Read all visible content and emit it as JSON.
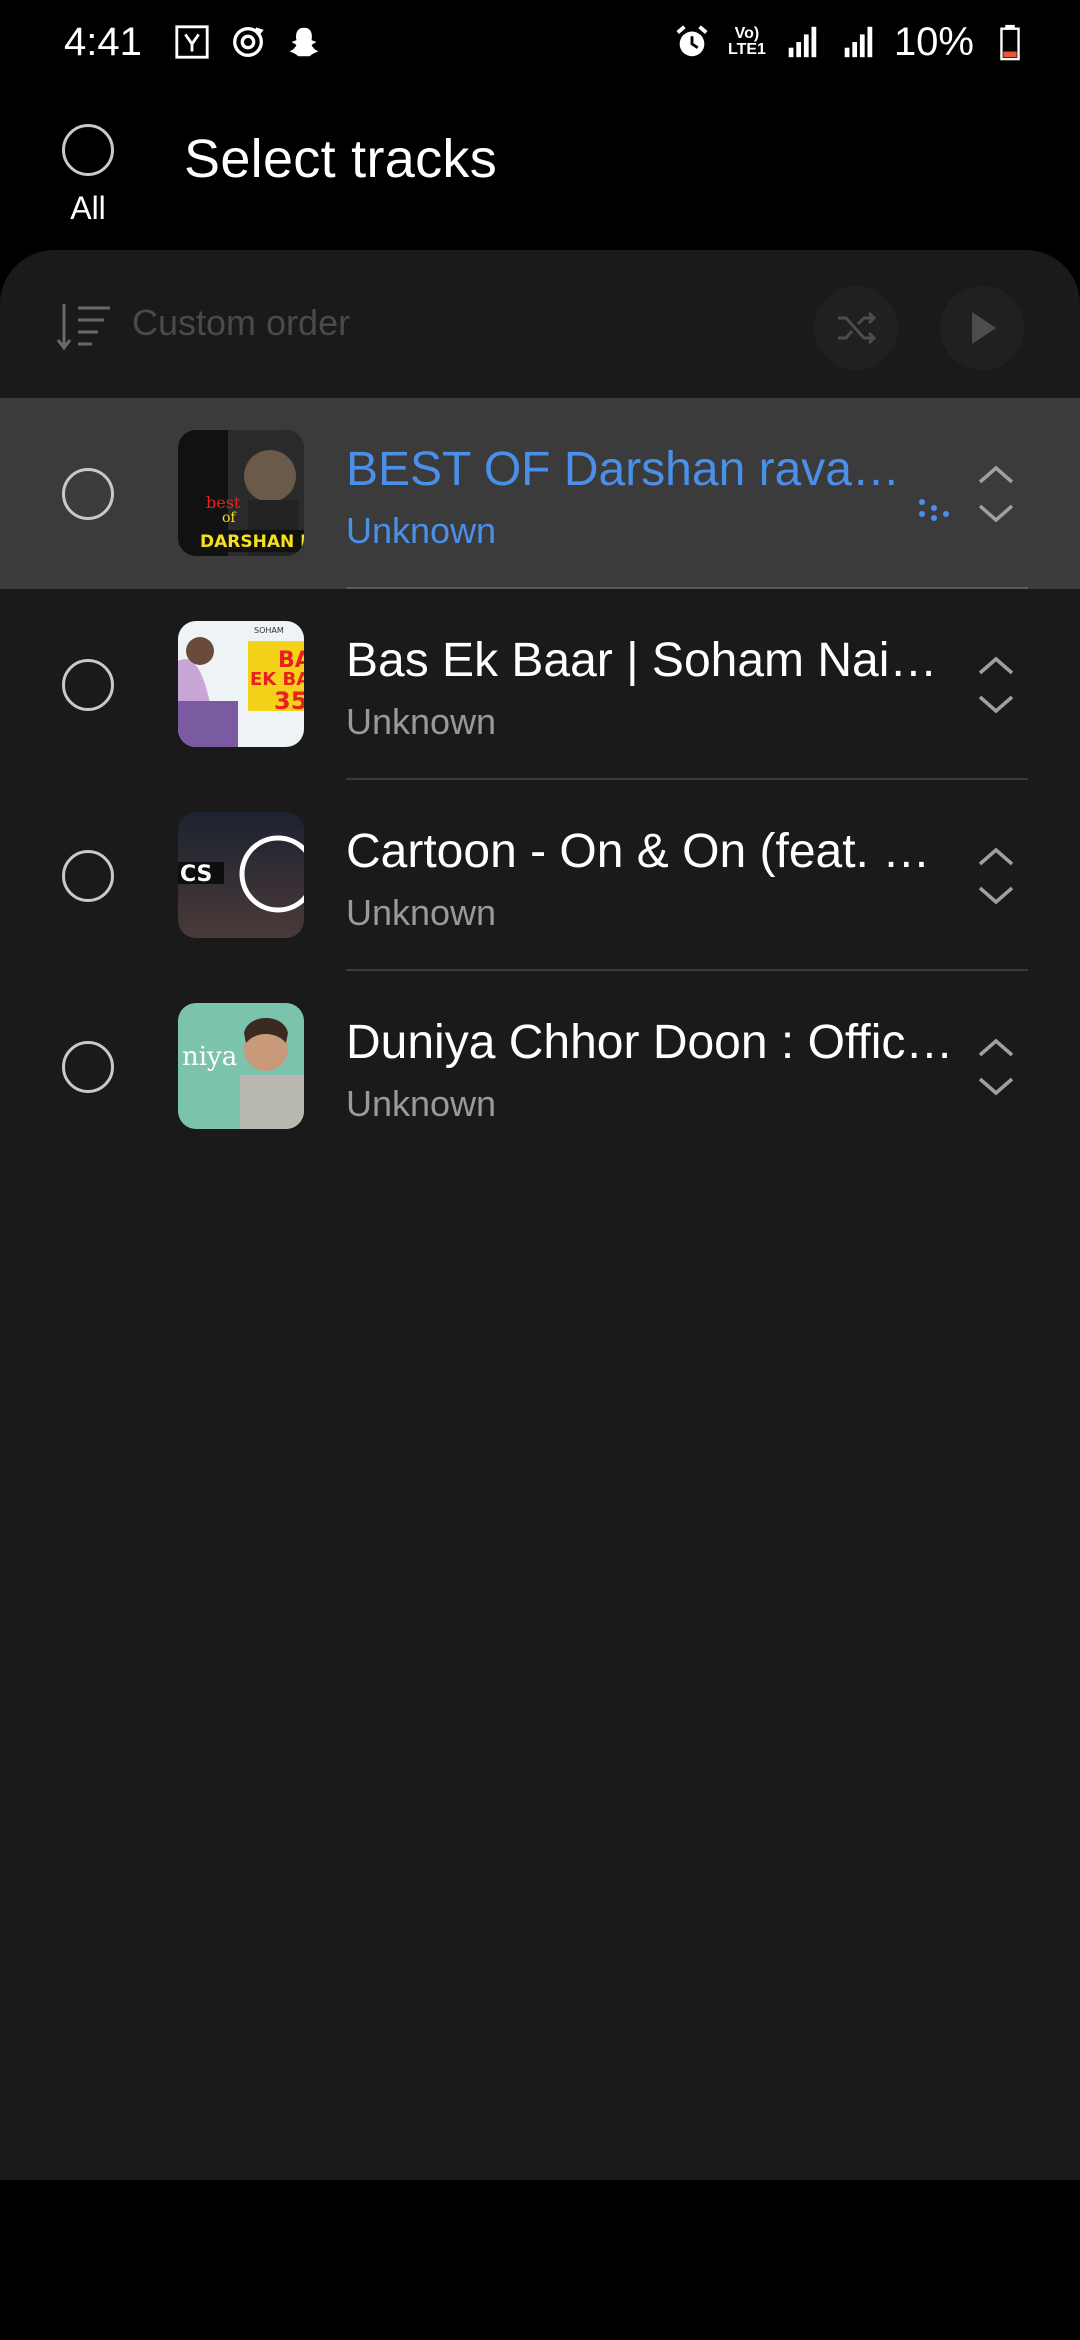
{
  "status_bar": {
    "time": "4:41",
    "battery": "10%",
    "net_top": "Vo)",
    "net_bottom": "LTE1"
  },
  "header": {
    "all_label": "All",
    "title": "Select tracks"
  },
  "toolbar": {
    "sort_label": "Custom order"
  },
  "tracks": [
    {
      "title": "BEST OF Darshan raval....",
      "artist": "Unknown",
      "highlighted": true
    },
    {
      "title": "Bas Ek Baar | Soham Naik,...",
      "artist": "Unknown",
      "highlighted": false
    },
    {
      "title": "Cartoon - On & On (feat. D...",
      "artist": "Unknown",
      "highlighted": false
    },
    {
      "title": "Duniya Chhor Doon : Offici...",
      "artist": "Unknown",
      "highlighted": false
    }
  ],
  "thumb_text": {
    "t1_best": "best",
    "t1_of": "of",
    "t1_name": "DARSHAN R",
    "t2_top": "BA",
    "t2_mid": "EK BA",
    "t2_num": "35",
    "t2_brand": "SOHAM",
    "t3_text": "CS",
    "t4_text": "niya"
  },
  "colors": {
    "accent_blue": "#4a8fe8",
    "panel_bg": "#1a1a1a",
    "highlight_bg": "#3b3b3b",
    "battery_low": "#e8553a"
  },
  "icons": {
    "sort": "sort-icon",
    "shuffle": "shuffle-icon",
    "play": "play-icon",
    "reorder": "reorder-icon",
    "drag": "drag-dots-icon"
  }
}
